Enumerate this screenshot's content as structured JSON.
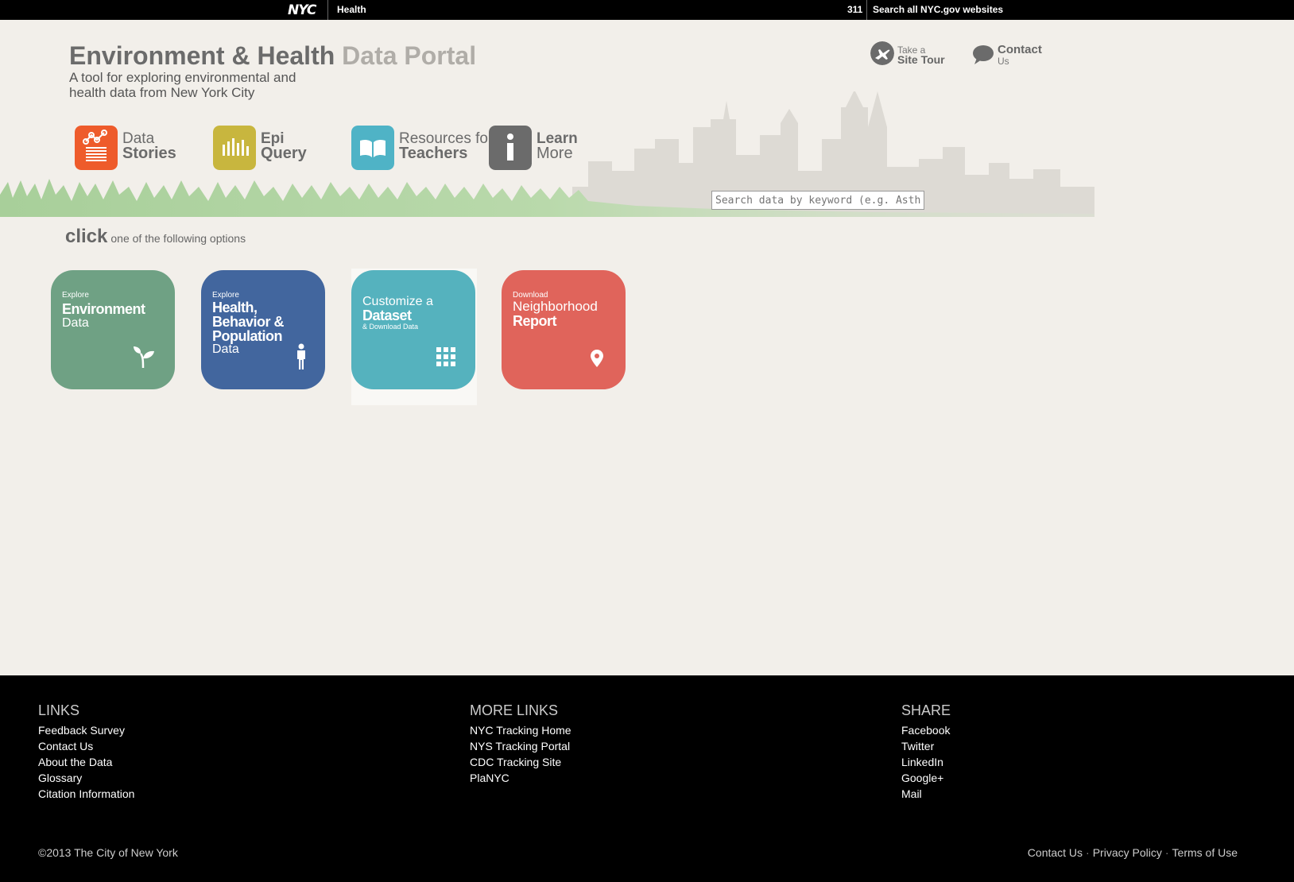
{
  "topbar": {
    "logo": "NYC",
    "agency": "Health",
    "n311": "311",
    "search_all": "Search all NYC.gov websites"
  },
  "header": {
    "title_main": "Environment & Health",
    "title_light": "Data Portal",
    "subtitle": "A tool for exploring environmental and health data from New York City",
    "tour_small": "Take a",
    "tour_big": "Site Tour",
    "contact_big": "Contact",
    "contact_small": "Us"
  },
  "tools": [
    {
      "top": "Data",
      "bottom": "Stories",
      "color": "#ee5b2b"
    },
    {
      "top": "Epi",
      "bottom": "Query",
      "color": "#c8b63e"
    },
    {
      "top": "Resources for",
      "bottom": "Teachers",
      "color": "#4fb3c6"
    },
    {
      "top": "Learn",
      "bottom": "More",
      "color": "#6b6b6b"
    }
  ],
  "search": {
    "placeholder": "Search data by keyword (e.g. Asthma)"
  },
  "prompt": {
    "click": "click",
    "rest": "one of the following options"
  },
  "cards": [
    {
      "small": "Explore",
      "big": "Environment",
      "reg": "Data",
      "color": "#6fa184",
      "icon": "sprout-icon"
    },
    {
      "small": "Explore",
      "big": "Health, Behavior & Population",
      "reg": "Data",
      "color": "#42669e",
      "icon": "person-icon"
    },
    {
      "reg_top": "Customize a",
      "big": "Dataset",
      "small": "& Download Data",
      "color": "#55b2be",
      "icon": "grid-icon"
    },
    {
      "small": "Download",
      "reg_top": "Neighborhood",
      "big": "Report",
      "color": "#e0645b",
      "icon": "map-pin-icon"
    }
  ],
  "footer": {
    "links_title": "LINKS",
    "links": [
      "Feedback Survey",
      "Contact Us",
      "About the Data",
      "Glossary",
      "Citation Information"
    ],
    "more_title": "MORE LINKS",
    "more": [
      "NYC Tracking Home",
      "NYS Tracking Portal",
      "CDC Tracking Site",
      "PlaNYC"
    ],
    "share_title": "SHARE",
    "share": [
      "Facebook",
      "Twitter",
      "LinkedIn",
      "Google+",
      "Mail"
    ],
    "copyright": "©2013 The City of New York",
    "bottom_links": [
      "Contact Us",
      "Privacy Policy",
      "Terms of Use"
    ]
  }
}
